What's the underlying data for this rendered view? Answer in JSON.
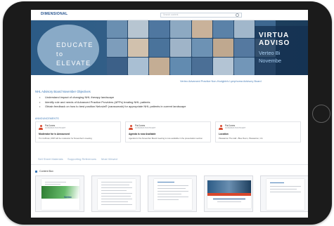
{
  "app": {
    "brand": "DIMENSIONAL",
    "search_placeholder": "Search content"
  },
  "hero": {
    "left_text_line1": "EDUCATE",
    "left_text_line2": "to",
    "left_text_line3": "ELEVATE",
    "title_line1": "VIRTUA",
    "title_line2": "ADVISO",
    "subtitle_line1": "Verteo Bi",
    "subtitle_line2": "Novembe"
  },
  "advisory_link": "Verteo Advanced Practice Non-Hodgkin's Lymphoma Advisory Board",
  "objectives": {
    "title": "NHL Advisory Board November Objectives",
    "items": [
      "Understand impact of changing NHL therapy landscape",
      "Identify role and needs of Advanced Practice Providers (APPs) treating NHL patients",
      "Obtain feedback on how to best position Nelovia® (varasumab) for appropriate NHL patients in current landscape"
    ]
  },
  "announcements": {
    "title": "ANNOUNCEMENTS",
    "cards": [
      {
        "name": "Pat Jones",
        "date": "10/16/2023 8:30 PM EDT",
        "headline": "Moderator for is Announced",
        "desc": "Tim Coffman, DNP will be moderator for November's meeting"
      },
      {
        "name": "Pat Jones",
        "date": "10/16/2023 8:30 PM EDT",
        "headline": "Agenda is now Available",
        "desc": "Agenda for the November Board meeting is now available in the presentation section"
      },
      {
        "name": "Pat Jones",
        "date": "10/16/2023 8:30 PM EDT",
        "headline": "Location",
        "desc": "Pleasanton The Hall - Blue Room, Pleasanton, CA"
      }
    ]
  },
  "tabs": [
    "Sell Sheet Materials",
    "Supporting References",
    "Most Viewed"
  ],
  "content_box": {
    "label": "Content Box"
  },
  "thumbnails": [
    {
      "name": "brochure"
    },
    {
      "name": "article"
    },
    {
      "name": "reference"
    },
    {
      "name": "advisory-board-slide"
    },
    {
      "name": "document"
    }
  ],
  "colors": {
    "accent": "#3a76b5",
    "hero_bg": "#2c5b86",
    "avatar": "#d8472c"
  }
}
